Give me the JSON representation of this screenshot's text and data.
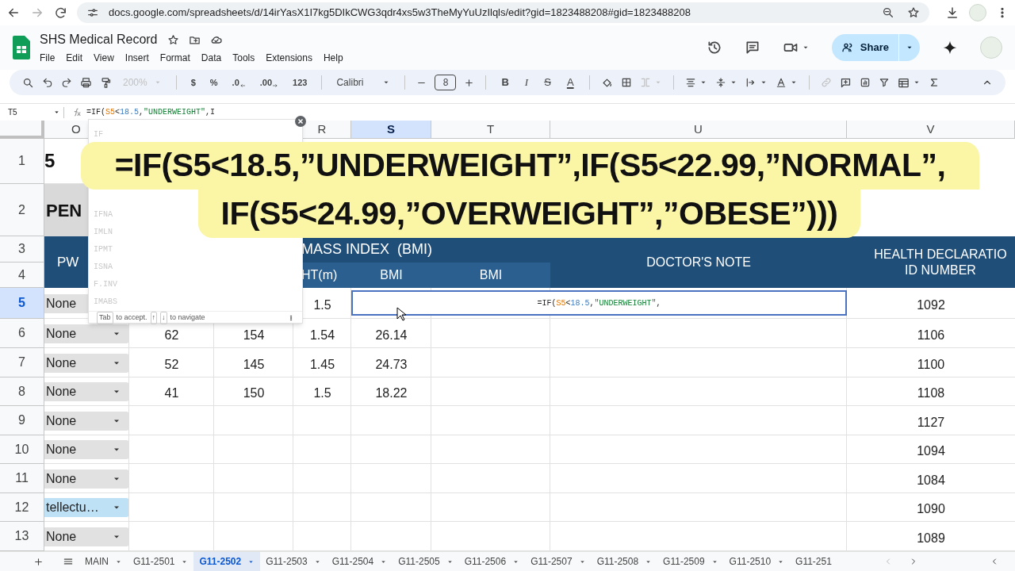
{
  "browser": {
    "url": "docs.google.com/spreadsheets/d/14irYasX1I7kg5DIkCWG3qdr4xs5w3TheMyYuUzIlqls/edit?gid=1823488208#gid=1823488208"
  },
  "document": {
    "title": "SHS Medical Record",
    "menus": [
      "File",
      "Edit",
      "View",
      "Insert",
      "Format",
      "Data",
      "Tools",
      "Extensions",
      "Help"
    ],
    "share": "Share"
  },
  "toolbar": {
    "zoom": "200%",
    "zoom_disabled": true,
    "number_formats": [
      {
        "text": "$",
        "kind": "plain"
      },
      {
        "text": "%",
        "kind": "plain"
      },
      {
        "text": ".0",
        "kind": "decrease"
      },
      {
        "text": ".00",
        "kind": "increase"
      },
      {
        "text": "123",
        "kind": "plain"
      }
    ],
    "font": "Calibri",
    "font_size": "8",
    "text_formats": [
      {
        "text": "B",
        "kind": "bold"
      },
      {
        "text": "I",
        "kind": "italic"
      },
      {
        "text": "S",
        "kind": "strike"
      },
      {
        "text": "A",
        "kind": "color"
      }
    ]
  },
  "formula_bar": {
    "cell_ref": "T5",
    "parts": [
      {
        "text": "=IF(",
        "kind": "plain"
      },
      {
        "text": "S5",
        "kind": "ref"
      },
      {
        "text": "<",
        "kind": "plain"
      },
      {
        "text": "18.5",
        "kind": "number"
      },
      {
        "text": ",",
        "kind": "plain"
      },
      {
        "text": "\"UNDERWEIGHT\"",
        "kind": "string"
      },
      {
        "text": ",I",
        "kind": "plain"
      }
    ]
  },
  "columns": [
    {
      "label": "O",
      "selected": false
    },
    {
      "label": "R",
      "selected": false
    },
    {
      "label": "S",
      "selected": true
    },
    {
      "label": "T",
      "selected": false
    },
    {
      "label": "U",
      "selected": false
    },
    {
      "label": "V",
      "selected": false
    }
  ],
  "sheet_header": {
    "title_fragment": "5",
    "subtitle_fragment": "PEN",
    "pwd": "PW",
    "bmi_group": "MASS INDEX  (BMI)",
    "height": "HT(m)",
    "bmi": "BMI",
    "bmi_result": "BMI",
    "doctor_note": "DOCTOR'S NOTE",
    "declaration": [
      "HEALTH DECLARATIO",
      "ID NUMBER"
    ]
  },
  "rows": [
    {
      "number": "1",
      "selected": false
    },
    {
      "number": "2",
      "selected": false
    },
    {
      "number": "3",
      "selected": false
    },
    {
      "number": "4",
      "selected": false
    },
    {
      "number": "5",
      "selected": true,
      "status": {
        "text": "None",
        "kind": "plain"
      },
      "height_m": "1.5",
      "id": "1092"
    },
    {
      "number": "6",
      "selected": false,
      "status": {
        "text": "None",
        "kind": "plain"
      },
      "weight": "62",
      "height_cm": "154",
      "height_m": "1.54",
      "bmi": "26.14",
      "id": "1106"
    },
    {
      "number": "7",
      "selected": false,
      "status": {
        "text": "None",
        "kind": "plain"
      },
      "weight": "52",
      "height_cm": "145",
      "height_m": "1.45",
      "bmi": "24.73",
      "id": "1100"
    },
    {
      "number": "8",
      "selected": false,
      "status": {
        "text": "None",
        "kind": "plain"
      },
      "weight": "41",
      "height_cm": "150",
      "height_m": "1.5",
      "bmi": "18.22",
      "id": "1108"
    },
    {
      "number": "9",
      "selected": false,
      "status": {
        "text": "None",
        "kind": "plain"
      },
      "id": "1127"
    },
    {
      "number": "10",
      "selected": false,
      "status": {
        "text": "None",
        "kind": "plain"
      },
      "id": "1094"
    },
    {
      "number": "11",
      "selected": false,
      "status": {
        "text": "None",
        "kind": "plain"
      },
      "id": "1084"
    },
    {
      "number": "12",
      "selected": false,
      "status": {
        "text": "tellectu…",
        "kind": "highlight"
      },
      "id": "1090"
    },
    {
      "number": "13",
      "selected": false,
      "status": {
        "text": "None",
        "kind": "plain"
      },
      "id": "1089"
    }
  ],
  "cell_editor": {
    "parts": [
      {
        "text": "=IF(",
        "kind": "plain"
      },
      {
        "text": "S5",
        "kind": "ref"
      },
      {
        "text": "<",
        "kind": "plain"
      },
      {
        "text": "18.5",
        "kind": "number"
      },
      {
        "text": ",",
        "kind": "plain"
      },
      {
        "text": "\"UNDERWEIGHT\"",
        "kind": "string"
      },
      {
        "text": ",",
        "kind": "plain"
      }
    ]
  },
  "autocomplete": {
    "items": [
      "IF",
      "IFNA",
      "IMLN",
      "IPMT",
      "ISNA",
      "F.INV",
      "IMABS"
    ],
    "key": "Tab",
    "accept": "to accept.",
    "up": "↑",
    "down": "↓",
    "navigate": "to navigate"
  },
  "caption": {
    "lines": [
      "=IF(S5<18.5,”UNDERWEIGHT”,IF(S5<22.99,”NORMAL”,",
      "IF(S5<24.99,”OVERWEIGHT”,”OBESE”)))"
    ]
  },
  "sheet_tabs": [
    {
      "label": "MAIN",
      "selected": false
    },
    {
      "label": "G11-2501",
      "selected": false
    },
    {
      "label": "G11-2502",
      "selected": true
    },
    {
      "label": "G11-2503",
      "selected": false
    },
    {
      "label": "G11-2504",
      "selected": false
    },
    {
      "label": "G11-2505",
      "selected": false
    },
    {
      "label": "G11-2506",
      "selected": false
    },
    {
      "label": "G11-2507",
      "selected": false
    },
    {
      "label": "G11-2508",
      "selected": false
    },
    {
      "label": "G11-2509",
      "selected": false
    },
    {
      "label": "G11-2510",
      "selected": false
    },
    {
      "label": "G11-251",
      "selected": false,
      "cut": true
    }
  ]
}
